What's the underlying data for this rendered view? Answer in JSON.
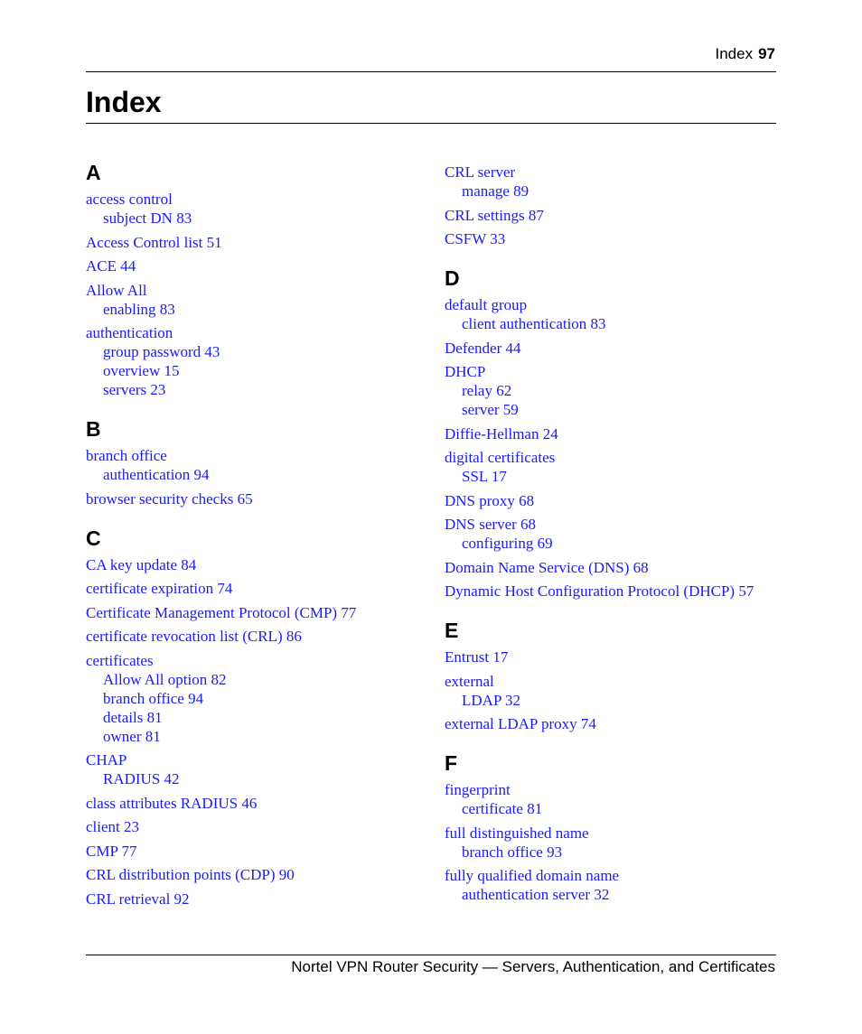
{
  "header": {
    "section_label": "Index",
    "page_number": "97"
  },
  "title": "Index",
  "footer": {
    "text": "Nortel VPN Router Security — Servers, Authentication, and Certificates"
  },
  "link_color": "#1a1aff",
  "columns": [
    {
      "sections": [
        {
          "letter": "A",
          "entries": [
            {
              "term": "access control",
              "subs": [
                "subject DN 83"
              ]
            },
            {
              "term": "Access Control list 51",
              "subs": []
            },
            {
              "term": "ACE 44",
              "subs": []
            },
            {
              "term": "Allow All",
              "subs": [
                "enabling 83"
              ]
            },
            {
              "term": "authentication",
              "subs": [
                "group password 43",
                "overview 15",
                "servers 23"
              ]
            }
          ]
        },
        {
          "letter": "B",
          "entries": [
            {
              "term": "branch office",
              "subs": [
                "authentication 94"
              ]
            },
            {
              "term": "browser security checks 65",
              "subs": []
            }
          ]
        },
        {
          "letter": "C",
          "entries": [
            {
              "term": "CA key update 84",
              "subs": []
            },
            {
              "term": "certificate expiration 74",
              "subs": []
            },
            {
              "term": "Certificate Management Protocol (CMP) 77",
              "subs": []
            },
            {
              "term": "certificate revocation list (CRL) 86",
              "subs": []
            },
            {
              "term": "certificates",
              "subs": [
                "Allow All option 82",
                "branch office 94",
                "details 81",
                "owner 81"
              ]
            },
            {
              "term": "CHAP",
              "subs": [
                "RADIUS 42"
              ]
            },
            {
              "term": "class attributes RADIUS 46",
              "subs": []
            },
            {
              "term": "client 23",
              "subs": []
            },
            {
              "term": "CMP 77",
              "subs": []
            },
            {
              "term": "CRL distribution points (CDP) 90",
              "subs": []
            },
            {
              "term": "CRL retrieval 92",
              "subs": []
            }
          ]
        }
      ]
    },
    {
      "sections": [
        {
          "letter": "",
          "entries": [
            {
              "term": "CRL server",
              "subs": [
                "manage 89"
              ]
            },
            {
              "term": "CRL settings 87",
              "subs": []
            },
            {
              "term": "CSFW 33",
              "subs": []
            }
          ]
        },
        {
          "letter": "D",
          "entries": [
            {
              "term": "default group",
              "subs": [
                "client authentication 83"
              ]
            },
            {
              "term": "Defender 44",
              "subs": []
            },
            {
              "term": "DHCP",
              "subs": [
                "relay 62",
                "server 59"
              ]
            },
            {
              "term": "Diffie-Hellman 24",
              "subs": []
            },
            {
              "term": "digital certificates",
              "subs": [
                "SSL 17"
              ]
            },
            {
              "term": "DNS proxy 68",
              "subs": []
            },
            {
              "term": "DNS server 68",
              "subs": [
                "configuring 69"
              ]
            },
            {
              "term": "Domain Name Service (DNS) 68",
              "subs": []
            },
            {
              "term": "Dynamic Host Configuration Protocol (DHCP) 57",
              "subs": []
            }
          ]
        },
        {
          "letter": "E",
          "entries": [
            {
              "term": "Entrust 17",
              "subs": []
            },
            {
              "term": "external",
              "subs": [
                "LDAP 32"
              ]
            },
            {
              "term": "external LDAP proxy 74",
              "subs": []
            }
          ]
        },
        {
          "letter": "F",
          "entries": [
            {
              "term": "fingerprint",
              "subs": [
                "certificate 81"
              ]
            },
            {
              "term": "full distinguished name",
              "subs": [
                "branch office 93"
              ]
            },
            {
              "term": "fully qualified domain name",
              "subs": [
                "authentication server 32"
              ]
            }
          ]
        }
      ]
    }
  ]
}
